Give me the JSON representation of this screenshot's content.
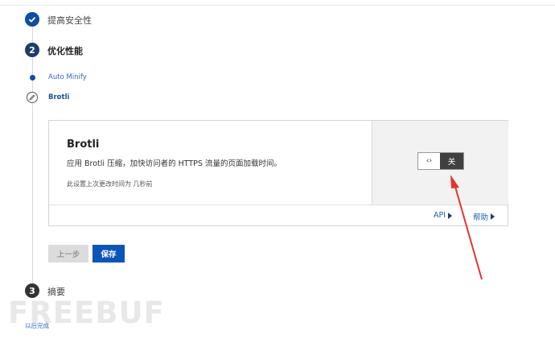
{
  "steps": [
    {
      "number": "",
      "label": "提高安全性",
      "state": "completed"
    },
    {
      "number": "2",
      "label": "优化性能",
      "state": "current"
    },
    {
      "number": "3",
      "label": "摘要",
      "state": "pending"
    }
  ],
  "substeps": [
    {
      "label": "Auto Minify",
      "state": "done"
    },
    {
      "label": "Brotli",
      "state": "current"
    }
  ],
  "card": {
    "title": "Brotli",
    "description": "应用 Brotli 压缩，加快访问者的 HTTPS 流量的页面加载时间。",
    "note": "此设置上次更改时间为 几秒前",
    "toggle": {
      "handle_glyph": "‹›",
      "state_label": "关"
    },
    "footer_links": {
      "api": "API",
      "help": "帮助"
    }
  },
  "buttons": {
    "prev": "上一步",
    "save": "保存"
  },
  "finish_later": "以后完成",
  "watermark": "FREEBUF",
  "colors": {
    "accent": "#0b55b8",
    "toggle_off": "#404040",
    "annotation_arrow": "#e3342f"
  }
}
